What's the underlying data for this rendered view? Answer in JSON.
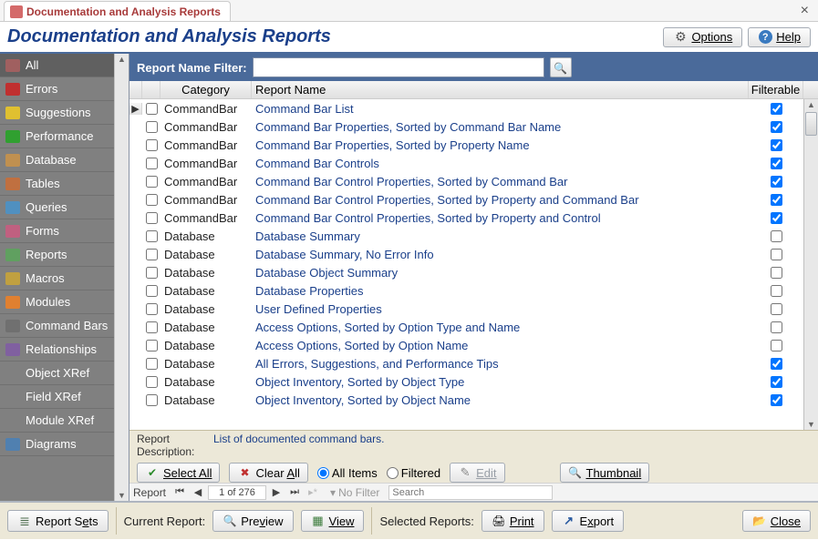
{
  "tab": {
    "title": "Documentation and Analysis Reports"
  },
  "header": {
    "title": "Documentation and Analysis Reports",
    "options": "Options",
    "help": "Help"
  },
  "sidebar": {
    "items": [
      {
        "label": "All",
        "selected": true,
        "color": "#a06060"
      },
      {
        "label": "Errors",
        "color": "#c03030"
      },
      {
        "label": "Suggestions",
        "color": "#e0c030"
      },
      {
        "label": "Performance",
        "color": "#30a030"
      },
      {
        "label": "Database",
        "color": "#c09050"
      },
      {
        "label": "Tables",
        "color": "#c07040"
      },
      {
        "label": "Queries",
        "color": "#5090c0"
      },
      {
        "label": "Forms",
        "color": "#c06080"
      },
      {
        "label": "Reports",
        "color": "#60a060"
      },
      {
        "label": "Macros",
        "color": "#c0a040"
      },
      {
        "label": "Modules",
        "color": "#e08030"
      },
      {
        "label": "Command Bars",
        "color": "#707070"
      },
      {
        "label": "Relationships",
        "color": "#8060a0"
      },
      {
        "label": "Object XRef",
        "color": "#808080"
      },
      {
        "label": "Field XRef",
        "color": "#808080"
      },
      {
        "label": "Module XRef",
        "color": "#808080"
      },
      {
        "label": "Diagrams",
        "color": "#5080b0"
      }
    ]
  },
  "filter": {
    "label": "Report Name Filter:",
    "value": ""
  },
  "grid": {
    "headers": {
      "category": "Category",
      "name": "Report Name",
      "filterable": "Filterable"
    },
    "rows": [
      {
        "sel": true,
        "cat": "CommandBar",
        "name": "Command Bar List",
        "filt": true
      },
      {
        "cat": "CommandBar",
        "name": "Command Bar Properties, Sorted by Command Bar Name",
        "filt": true
      },
      {
        "cat": "CommandBar",
        "name": "Command Bar Properties, Sorted by Property Name",
        "filt": true
      },
      {
        "cat": "CommandBar",
        "name": "Command Bar Controls",
        "filt": true
      },
      {
        "cat": "CommandBar",
        "name": "Command Bar Control Properties, Sorted by Command Bar",
        "filt": true
      },
      {
        "cat": "CommandBar",
        "name": "Command Bar Control Properties, Sorted by Property and Command Bar",
        "filt": true
      },
      {
        "cat": "CommandBar",
        "name": "Command Bar Control Properties, Sorted by Property and Control",
        "filt": true
      },
      {
        "cat": "Database",
        "name": "Database Summary",
        "filt": false
      },
      {
        "cat": "Database",
        "name": "Database Summary, No Error Info",
        "filt": false
      },
      {
        "cat": "Database",
        "name": "Database Object Summary",
        "filt": false
      },
      {
        "cat": "Database",
        "name": "Database Properties",
        "filt": false
      },
      {
        "cat": "Database",
        "name": "User Defined Properties",
        "filt": false
      },
      {
        "cat": "Database",
        "name": "Access Options, Sorted by Option Type and Name",
        "filt": false
      },
      {
        "cat": "Database",
        "name": "Access Options, Sorted by Option Name",
        "filt": false
      },
      {
        "cat": "Database",
        "name": "All Errors, Suggestions, and Performance Tips",
        "filt": true
      },
      {
        "cat": "Database",
        "name": "Object Inventory, Sorted by Object Type",
        "filt": true
      },
      {
        "cat": "Database",
        "name": "Object Inventory, Sorted by Object Name",
        "filt": true
      }
    ]
  },
  "description": {
    "label": "Report Description:",
    "text": "List of documented command bars.",
    "select_all": "Select All",
    "clear_all": "Clear All",
    "all_items": "All Items",
    "filtered": "Filtered",
    "edit": "Edit",
    "thumbnail": "Thumbnail"
  },
  "recnav": {
    "label": "Report",
    "counter": "1 of 276",
    "nofilter": "No Filter",
    "search_placeholder": "Search"
  },
  "footer": {
    "report_sets": "Report Sets",
    "current_report": "Current Report:",
    "preview": "Preview",
    "view": "View",
    "selected_reports": "Selected Reports:",
    "print": "Print",
    "export": "Export",
    "close": "Close"
  }
}
